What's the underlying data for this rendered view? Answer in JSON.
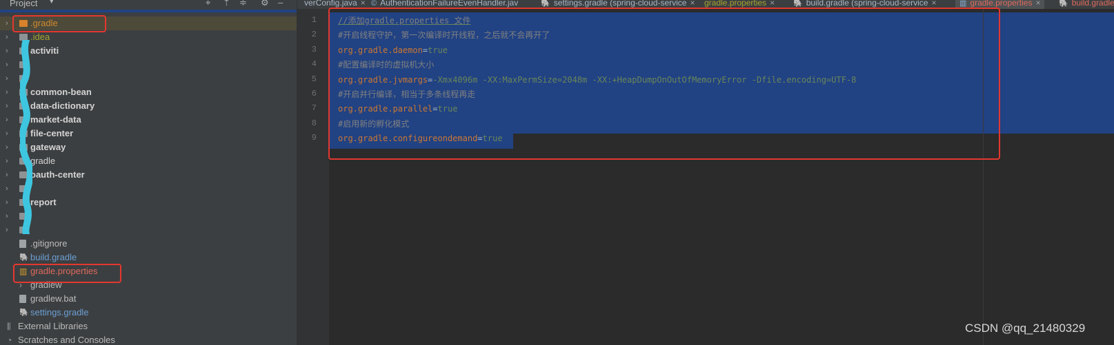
{
  "project_panel": {
    "title": "Project",
    "header_icons": [
      "crosshair-icon",
      "collapse-icon",
      "expand-icon",
      "gear-icon",
      "minimize-icon"
    ],
    "tree": [
      {
        "label": ".gradle",
        "type": "folder-orange",
        "expandable": true,
        "color": "#d08a2e",
        "selected": true
      },
      {
        "label": ".idea",
        "type": "folder",
        "expandable": true,
        "color": "#a7a52e"
      },
      {
        "label": "activiti",
        "type": "module",
        "expandable": true,
        "color": "#d4d4d4",
        "bold": true
      },
      {
        "label": "",
        "type": "module",
        "expandable": true,
        "color": "#d4d4d4"
      },
      {
        "label": "",
        "type": "module",
        "expandable": true,
        "color": "#d4d4d4"
      },
      {
        "label": "common-bean",
        "type": "module",
        "expandable": true,
        "color": "#d4d4d4",
        "bold": true
      },
      {
        "label": "data-dictionary",
        "type": "module",
        "expandable": true,
        "color": "#d4d4d4",
        "bold": true
      },
      {
        "label": "market-data",
        "type": "module",
        "expandable": true,
        "color": "#d4d4d4",
        "bold": true
      },
      {
        "label": "file-center",
        "type": "module",
        "expandable": true,
        "color": "#d4d4d4",
        "bold": true
      },
      {
        "label": "gateway",
        "type": "module",
        "expandable": true,
        "color": "#d4d4d4",
        "bold": true
      },
      {
        "label": "gradle",
        "type": "folder",
        "expandable": true,
        "color": "#d4d4d4"
      },
      {
        "label": "oauth-center",
        "type": "module",
        "expandable": true,
        "color": "#d4d4d4",
        "bold": true
      },
      {
        "label": "",
        "type": "module",
        "expandable": true,
        "color": "#d4d4d4"
      },
      {
        "label": "report",
        "type": "module",
        "expandable": true,
        "color": "#d4d4d4",
        "bold": true
      },
      {
        "label": "",
        "type": "module",
        "expandable": true,
        "color": "#d4d4d4"
      },
      {
        "label": "",
        "type": "module",
        "expandable": true,
        "color": "#d4d4d4"
      },
      {
        "label": ".gitignore",
        "type": "file",
        "expandable": false,
        "color": "#bbbbbb"
      },
      {
        "label": "build.gradle",
        "type": "gradle-file",
        "expandable": false,
        "color": "#6c9fd4"
      },
      {
        "label": "gradle.properties",
        "type": "properties-file",
        "expandable": false,
        "color": "#e06a5c"
      },
      {
        "label": "gradlew",
        "type": "script-file",
        "expandable": false,
        "color": "#bbbbbb"
      },
      {
        "label": "gradlew.bat",
        "type": "file",
        "expandable": false,
        "color": "#bbbbbb"
      },
      {
        "label": "settings.gradle",
        "type": "gradle-file",
        "expandable": false,
        "color": "#6c9fd4"
      },
      {
        "label": "External Libraries",
        "type": "library",
        "expandable": false,
        "color": "#bbbbbb"
      },
      {
        "label": "Scratches and Consoles",
        "type": "scratch",
        "expandable": false,
        "color": "#bbbbbb"
      }
    ]
  },
  "tabs": [
    {
      "label": "verConfig.java",
      "icon": "",
      "close": "×"
    },
    {
      "label": "AuthenticationFailureEvenHandler.jav",
      "icon": "class-icon",
      "close": ""
    },
    {
      "label": "settings.gradle (spring-cloud-service",
      "icon": "gradle-icon",
      "close": "×"
    },
    {
      "label": "gradle.properties",
      "icon": "",
      "close": "×",
      "color": "#a7a52e"
    },
    {
      "label": "build.gradle (spring-cloud-service",
      "icon": "gradle-icon",
      "close": "×"
    },
    {
      "label": "gradle.properties",
      "icon": "properties-icon",
      "close": "×",
      "color": "#e06a5c",
      "active": true
    },
    {
      "label": "build.gradle",
      "icon": "gradle-icon",
      "close": "",
      "color": "#e06a5c"
    }
  ],
  "editor": {
    "line_numbers": [
      "1",
      "2",
      "3",
      "4",
      "5",
      "6",
      "7",
      "8",
      "9"
    ],
    "lines": [
      {
        "type": "comment-ul",
        "text": "//添加gradle.properties 文件"
      },
      {
        "type": "comment",
        "text": "#开启线程守护，第一次编译时开线程，之后就不会再开了"
      },
      {
        "type": "kv",
        "key": "org.gradle.daemon",
        "eq": "=",
        "value": "true"
      },
      {
        "type": "comment",
        "text": "#配置编译时的虚拟机大小"
      },
      {
        "type": "kv",
        "key": "org.gradle.jvmargs",
        "eq": "=",
        "value": "-Xmx4096m -XX:MaxPermSize=2048m -XX:+HeapDumpOnOutOfMemoryError -Dfile.encoding=UTF-8"
      },
      {
        "type": "comment",
        "text": "#开启并行编译，相当于多条线程再走"
      },
      {
        "type": "kv",
        "key": "org.gradle.parallel",
        "eq": "=",
        "value": "true"
      },
      {
        "type": "comment",
        "text": "#启用新的孵化模式"
      },
      {
        "type": "kv",
        "key": "org.gradle.configureondemand",
        "eq": "=",
        "value": "true"
      }
    ]
  },
  "watermark": "CSDN @qq_21480329",
  "colors": {
    "selection": "#214283",
    "annotation_red": "#e5372f",
    "key": "#cc7832",
    "value": "#6a8759",
    "comment": "#808080"
  }
}
